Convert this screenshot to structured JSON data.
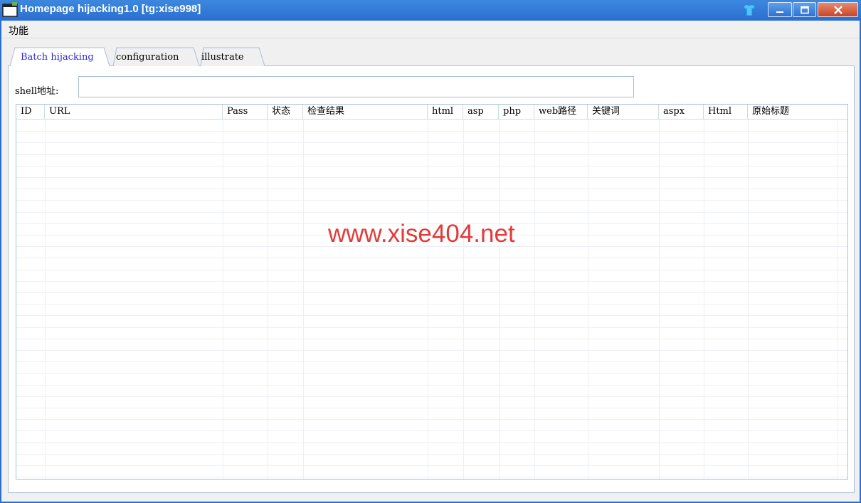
{
  "window": {
    "title": "Homepage hijacking1.0 [tg:xise998]",
    "icons": {
      "app": "app-window-icon",
      "skin": "shirt-skin-icon",
      "minimize": "minimize-icon",
      "maximize": "maximize-icon",
      "close": "close-icon"
    },
    "colors": {
      "titlebar": "#2a6ed0",
      "close": "#c6452a"
    }
  },
  "menu": {
    "items": [
      {
        "label": "功能"
      }
    ]
  },
  "tabs": [
    {
      "label": "Batch hijacking",
      "active": true
    },
    {
      "label": "configuration",
      "active": false
    },
    {
      "label": "illustrate",
      "active": false
    }
  ],
  "shell": {
    "label": "shell地址:",
    "value": "",
    "placeholder": ""
  },
  "grid": {
    "columns": [
      "ID",
      "URL",
      "Pass",
      "状态",
      "检查结果",
      "html",
      "asp",
      "php",
      "web路径",
      "关键词",
      "aspx",
      "Html",
      "原始标题"
    ],
    "rows": []
  },
  "watermark": {
    "text": "www.xise404.net",
    "color": "#e43a3a"
  }
}
